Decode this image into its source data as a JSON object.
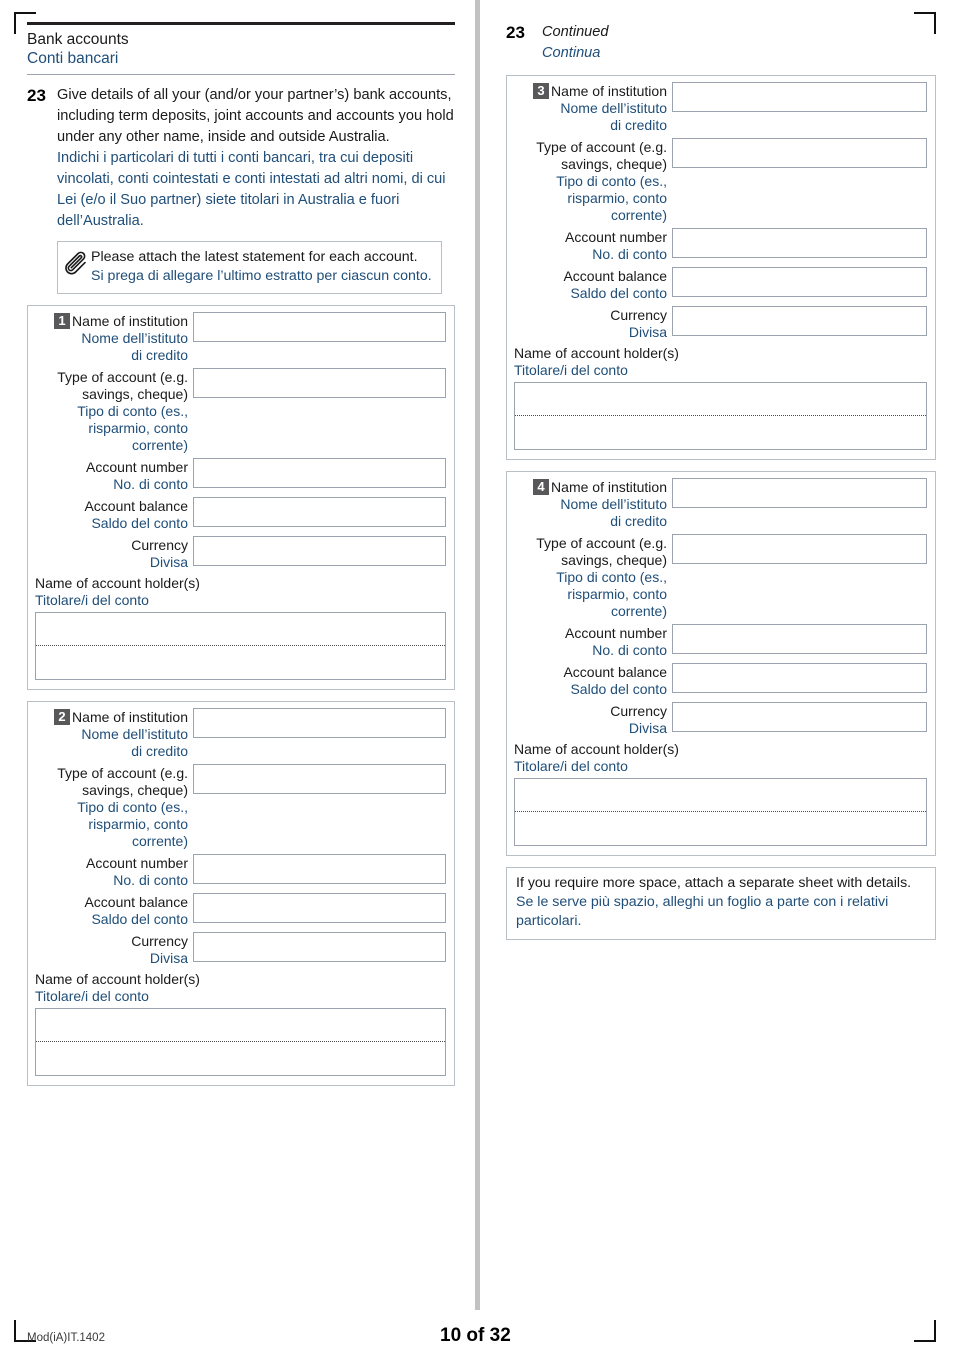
{
  "page": {
    "section_title_en": "Bank accounts",
    "section_title_it": "Conti bancari",
    "footer_code": "Mod(iA)IT.1402",
    "footer_page": "10 of 32",
    "accent_blue": "#1f4e79",
    "badge_gray": "#58585b",
    "rule_dark": "#231f20"
  },
  "question": {
    "number": "23",
    "en_text": "Give details of all your (and/or your partner’s) bank accounts, including term deposits, joint accounts and accounts you hold under any other name, inside and outside Australia.",
    "it_text": "Indichi i particolari di tutti i conti bancari, tra cui depositi vincolati, conti cointestati e conti intestati ad altri nomi, di cui Lei (e/o il Suo partner) siete titolari in Australia e fuori dell’Australia."
  },
  "note": {
    "icon": "paperclip-icon",
    "en_text": "Please attach the latest statement for each account.",
    "it_text": "Si prega di allegare l’ultimo estratto per ciascun conto."
  },
  "continued": {
    "number": "23",
    "en_text": "Continued",
    "it_text": "Continua"
  },
  "field_labels": {
    "institution_en": "Name of institution",
    "institution_it_line1": "Nome dell’istituto",
    "institution_it_line2": "di credito",
    "type_en_line1": "Type of account (e.g.",
    "type_en_line2": "savings, cheque)",
    "type_it_line1": "Tipo di conto (es.,",
    "type_it_line2": "risparmio, conto",
    "type_it_line3": "corrente)",
    "number_en": "Account number",
    "number_it": "No. di conto",
    "balance_en": "Account balance",
    "balance_it": "Saldo del conto",
    "currency_en": "Currency",
    "currency_it": "Divisa",
    "holder_en": "Name of account holder(s)",
    "holder_it": "Titolare/i del conto"
  },
  "accounts": [
    {
      "badge": "1",
      "institution": "",
      "type": "",
      "number": "",
      "balance": "",
      "currency": "",
      "holder": ""
    },
    {
      "badge": "2",
      "institution": "",
      "type": "",
      "number": "",
      "balance": "",
      "currency": "",
      "holder": ""
    },
    {
      "badge": "3",
      "institution": "",
      "type": "",
      "number": "",
      "balance": "",
      "currency": "",
      "holder": ""
    },
    {
      "badge": "4",
      "institution": "",
      "type": "",
      "number": "",
      "balance": "",
      "currency": "",
      "holder": ""
    }
  ],
  "more_space": {
    "en_text": "If you require more space, attach a separate sheet with details.",
    "it_text": "Se le serve più spazio, alleghi un foglio a parte con i relativi particolari."
  }
}
